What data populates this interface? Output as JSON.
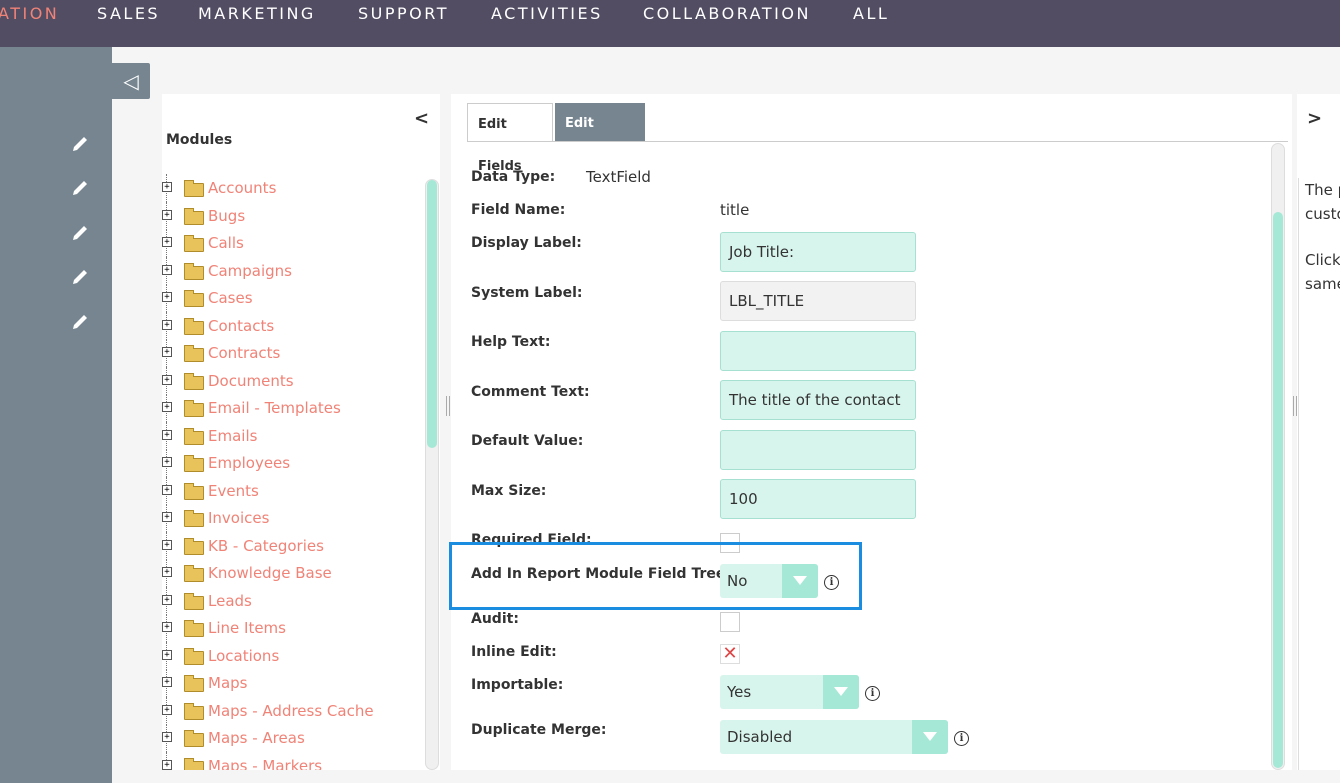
{
  "topnav": {
    "items": [
      "ATION",
      "SALES",
      "MARKETING",
      "SUPPORT",
      "ACTIVITIES",
      "COLLABORATION",
      "ALL"
    ]
  },
  "sidebar": {
    "collapse_icon": "◁"
  },
  "modules": {
    "title": "Modules",
    "collapse_icon": "<",
    "items": [
      "Accounts",
      "Bugs",
      "Calls",
      "Campaigns",
      "Cases",
      "Contacts",
      "Contracts",
      "Documents",
      "Email - Templates",
      "Emails",
      "Employees",
      "Events",
      "Invoices",
      "KB - Categories",
      "Knowledge Base",
      "Leads",
      "Line Items",
      "Locations",
      "Maps",
      "Maps - Address Cache",
      "Maps - Areas",
      "Maps - Markers"
    ]
  },
  "tabs": {
    "edit_fields": "Edit Fields",
    "edit_field": "Edit Field"
  },
  "form": {
    "data_type_label": "Data Type:",
    "data_type_value": "TextField",
    "field_name_label": "Field Name:",
    "field_name_value": "title",
    "display_label_label": "Display Label:",
    "display_label_value": "Job Title:",
    "system_label_label": "System Label:",
    "system_label_value": "LBL_TITLE",
    "help_text_label": "Help Text:",
    "help_text_value": "",
    "comment_text_label": "Comment Text:",
    "comment_text_value": "The title of the contact",
    "default_value_label": "Default Value:",
    "default_value_value": "",
    "max_size_label": "Max Size:",
    "max_size_value": "100",
    "required_label": "Required Field:",
    "report_tree_label": "Add In Report Module Field Tree:",
    "report_tree_value": "No",
    "audit_label": "Audit:",
    "inline_edit_label": "Inline Edit:",
    "inline_edit_mark": "✕",
    "importable_label": "Importable:",
    "importable_value": "Yes",
    "duplicate_merge_label": "Duplicate Merge:",
    "duplicate_merge_value": "Disabled"
  },
  "help": {
    "collapse_icon": ">",
    "lines": [
      "The p",
      "custo",
      "Click",
      "same"
    ]
  },
  "colors": {
    "nav_bg": "#534d64",
    "accent": "#f08377",
    "mint": "#a5e8d6",
    "highlight": "#1a8de0"
  }
}
